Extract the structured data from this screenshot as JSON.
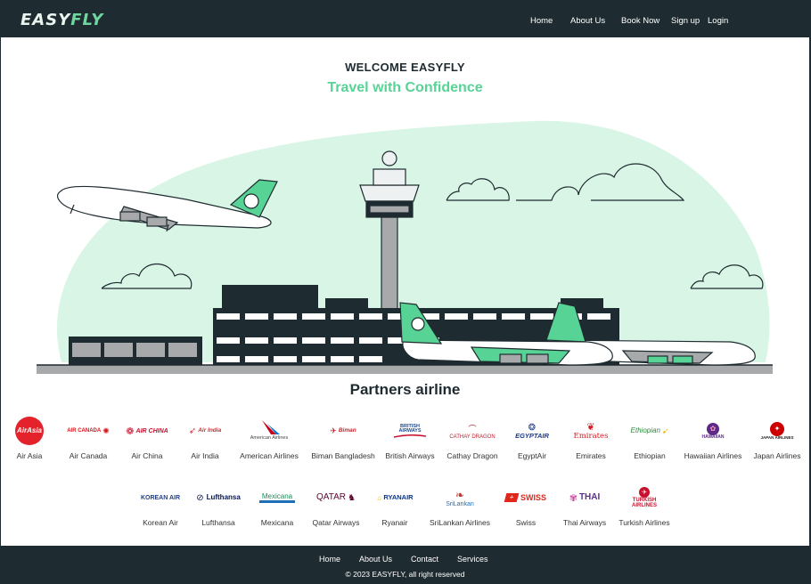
{
  "brand": {
    "logo_part1": "EASY",
    "logo_part2": "FLY",
    "accent": "#58d396",
    "dark": "#1e2b30"
  },
  "nav": {
    "home": "Home",
    "about": "About Us",
    "book": "Book Now",
    "signup": "Sign up",
    "login": "Login"
  },
  "hero": {
    "welcome": "WELCOME EASYFLY",
    "tagline": "Travel with Confidence"
  },
  "partners": {
    "title": "Partners airline",
    "row1": [
      {
        "name": "Air Asia",
        "logo_text": "AirAsia",
        "color": "#e3222b"
      },
      {
        "name": "Air Canada",
        "logo_text": "AIR CANADA",
        "color": "#d5141c"
      },
      {
        "name": "Air China",
        "logo_text": "AIR CHINA",
        "color": "#c8102e"
      },
      {
        "name": "Air India",
        "logo_text": "Air India",
        "color": "#d6262d"
      },
      {
        "name": "American Airlines",
        "logo_text": "American Airlines",
        "color": "#0f69b4"
      },
      {
        "name": "Biman Bangladesh",
        "logo_text": "Biman",
        "color": "#c6232b"
      },
      {
        "name": "British Airways",
        "logo_text": "BRITISH AIRWAYS",
        "color": "#1d4b8f"
      },
      {
        "name": "Cathay Dragon",
        "logo_text": "CATHAY DRAGON",
        "color": "#bf1e2e"
      },
      {
        "name": "EgyptAir",
        "logo_text": "EGYPTAIR",
        "color": "#1a3a8c"
      },
      {
        "name": "Emirates",
        "logo_text": "Emirates",
        "color": "#d71921"
      },
      {
        "name": "Ethiopian",
        "logo_text": "Ethiopian",
        "color": "#2e8b3c"
      },
      {
        "name": "Hawaiian Airlines",
        "logo_text": "HAWAIIAN",
        "color": "#5b2a86"
      },
      {
        "name": "Japan Airlines",
        "logo_text": "JAPAN AIRLINES",
        "color": "#cc0000"
      }
    ],
    "row2": [
      {
        "name": "Korean Air",
        "logo_text": "KOREAN AIR",
        "color": "#1d3f8a"
      },
      {
        "name": "Lufthansa",
        "logo_text": "Lufthansa",
        "color": "#05164d"
      },
      {
        "name": "Mexicana",
        "logo_text": "Mexicana",
        "color": "#1b8a5a"
      },
      {
        "name": "Qatar Airways",
        "logo_text": "QATAR",
        "color": "#5c0632"
      },
      {
        "name": "Ryanair",
        "logo_text": "RYANAIR",
        "color": "#073590"
      },
      {
        "name": "SriLankan Airlines",
        "logo_text": "SriLankan",
        "color": "#1d6fb8"
      },
      {
        "name": "Swiss",
        "logo_text": "SWISS",
        "color": "#e1261c"
      },
      {
        "name": "Thai Airways",
        "logo_text": "THAI",
        "color": "#5c2d91"
      },
      {
        "name": "Turkish Airlines",
        "logo_text": "TURKISH AIRLINES",
        "color": "#c8102e"
      }
    ]
  },
  "footer": {
    "home": "Home",
    "about": "About Us",
    "contact": "Contact",
    "services": "Services",
    "copyright": "© 2023 EASYFLY, all right reserved"
  }
}
